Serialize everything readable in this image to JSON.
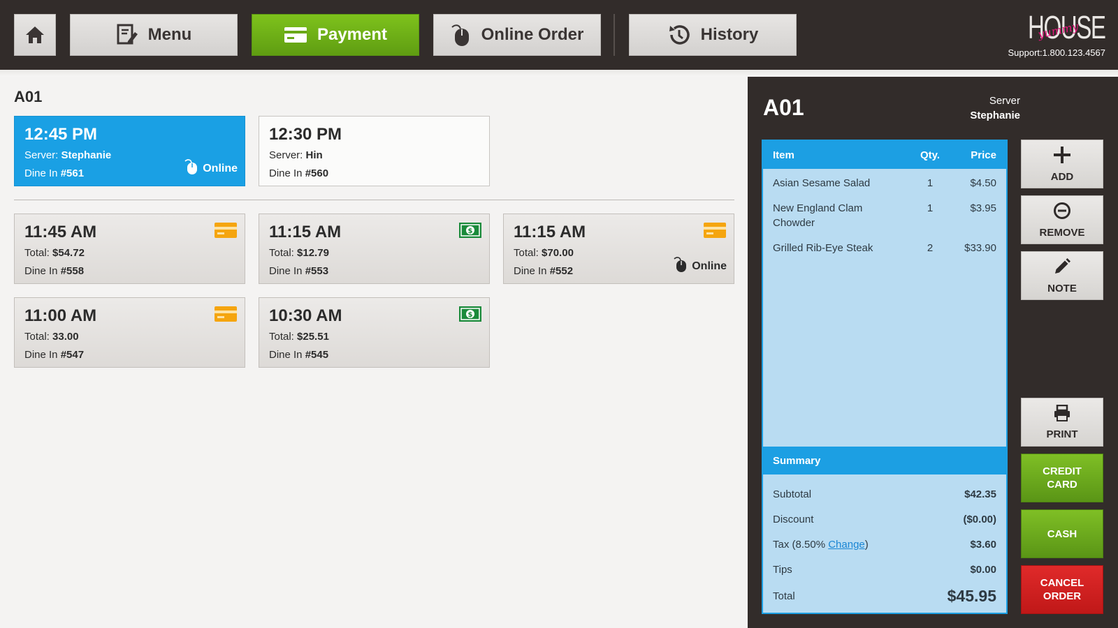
{
  "nav": {
    "home_label": "",
    "tabs": [
      {
        "label": "Menu",
        "icon": "menu-icon"
      },
      {
        "label": "Payment",
        "icon": "card-icon",
        "active": true
      },
      {
        "label": "Online Order",
        "icon": "mouse-icon"
      },
      {
        "label": "History",
        "icon": "history-icon"
      }
    ]
  },
  "brand": {
    "logo_script": "yummy",
    "logo_word": "HOUSE",
    "support": "Support:1.800.123.4567"
  },
  "left": {
    "table_label": "A01",
    "open_tickets": [
      {
        "time": "12:45 PM",
        "server_prefix": "Server: ",
        "server": "Stephanie",
        "dine_prefix": "Dine In ",
        "number": "#561",
        "online_label": "Online",
        "selected": true
      },
      {
        "time": "12:30 PM",
        "server_prefix": "Server: ",
        "server": "Hin",
        "dine_prefix": "Dine In ",
        "number": "#560"
      }
    ],
    "closed_tickets": [
      {
        "time": "11:45 AM",
        "total_prefix": "Total: ",
        "total": "$54.72",
        "dine_prefix": "Dine In ",
        "number": "#558",
        "payment": "card"
      },
      {
        "time": "11:15 AM",
        "total_prefix": "Total: ",
        "total": "$12.79",
        "dine_prefix": "Dine In ",
        "number": "#553",
        "payment": "cash"
      },
      {
        "time": "11:15 AM",
        "total_prefix": "Total: ",
        "total": "$70.00",
        "dine_prefix": "Dine In ",
        "number": "#552",
        "payment": "card",
        "online_label": "Online"
      },
      {
        "time": "11:00 AM",
        "total_prefix": "Total: ",
        "total": "33.00",
        "dine_prefix": "Dine In ",
        "number": "#547",
        "payment": "card"
      },
      {
        "time": "10:30 AM",
        "total_prefix": "Total: ",
        "total": "$25.51",
        "dine_prefix": "Dine In ",
        "number": "#545",
        "payment": "cash"
      }
    ]
  },
  "order": {
    "title": "A01",
    "server_label": "Server",
    "server_name": "Stephanie",
    "headers": {
      "item": "Item",
      "qty": "Qty.",
      "price": "Price"
    },
    "items": [
      {
        "name": "Asian Sesame Salad",
        "qty": "1",
        "price": "$4.50"
      },
      {
        "name": "New England Clam Chowder",
        "qty": "1",
        "price": "$3.95"
      },
      {
        "name": "Grilled Rib-Eye Steak",
        "qty": "2",
        "price": "$33.90"
      }
    ],
    "summary": {
      "title": "Summary",
      "subtotal_label": "Subtotal",
      "subtotal": "$42.35",
      "discount_label": "Discount",
      "discount": "($0.00)",
      "tax_label": "Tax (8.50% ",
      "tax_link": "Change",
      "tax_close": ")",
      "tax": "$3.60",
      "tips_label": "Tips",
      "tips": "$0.00",
      "total_label": "Total",
      "total": "$45.95"
    }
  },
  "actions": {
    "add": "ADD",
    "remove": "REMOVE",
    "note": "NOTE",
    "print": "PRINT",
    "credit_card_1": "CREDIT",
    "credit_card_2": "CARD",
    "cash": "CASH",
    "cancel_1": "CANCEL",
    "cancel_2": "ORDER"
  },
  "colors": {
    "accent_blue": "#1aa0e4",
    "payment_green": "#6fb11a",
    "cancel_red": "#d11f1f",
    "card_orange": "#f5a50f",
    "cash_green": "#1a8a3a",
    "dark_bg": "#322c2a"
  }
}
